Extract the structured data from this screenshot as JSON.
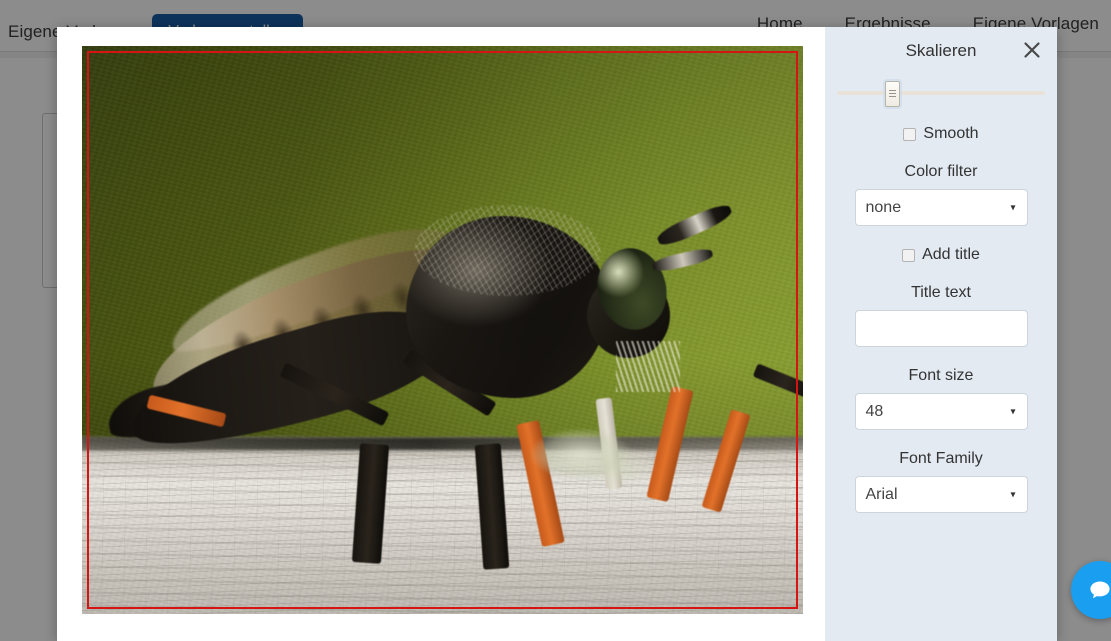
{
  "nav": {
    "left_link": "Eigene Vorlagen",
    "create_button": "Vorlage erstellen",
    "right_links": [
      {
        "label": "Home"
      },
      {
        "label": "Ergebnisse"
      },
      {
        "label": "Eigene Vorlagen"
      }
    ]
  },
  "modal": {
    "panel_title": "Skalieren",
    "close_icon": "close-x-icon",
    "scale_slider": {
      "name": "scale-slider",
      "position_percent": 23
    },
    "smooth": {
      "label": "Smooth",
      "checked": false
    },
    "color_filter": {
      "label": "Color filter",
      "value": "none",
      "caret": "▾"
    },
    "add_title": {
      "label": "Add title",
      "checked": false
    },
    "title_text": {
      "label": "Title text",
      "value": "",
      "placeholder": ""
    },
    "font_size": {
      "label": "Font size",
      "value": "48",
      "caret": "▾"
    },
    "font_family": {
      "label": "Font Family",
      "value": "Arial",
      "caret": "▾"
    },
    "canvas": {
      "name": "image-canvas",
      "selection_border_color": "#d71414",
      "image_subject": "robber-fly-macro-photo"
    }
  },
  "chat": {
    "icon": "chat-bubble-icon",
    "color": "#1a9ef0"
  }
}
